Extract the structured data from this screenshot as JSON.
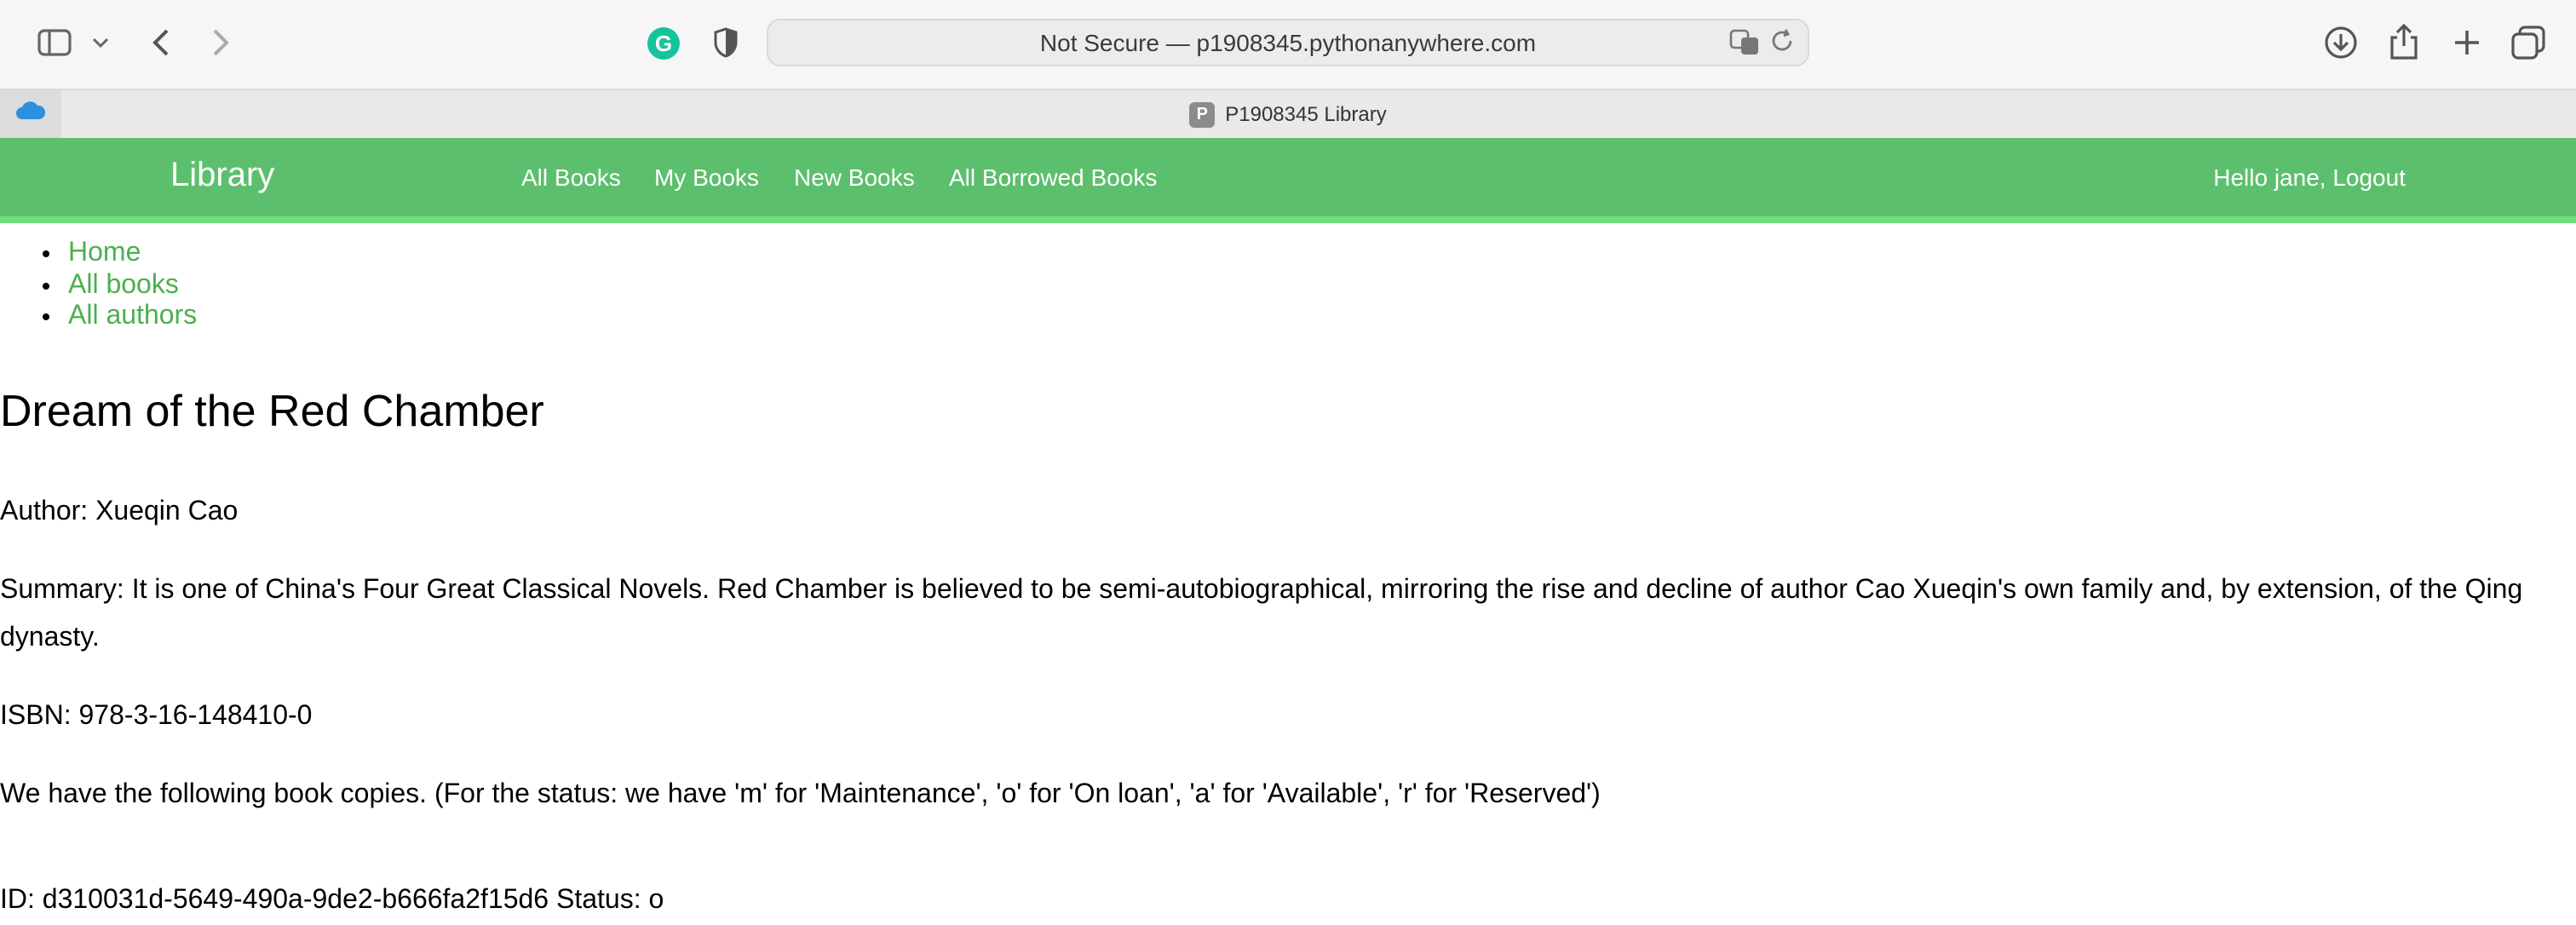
{
  "browser": {
    "address": "Not Secure — p1908345.pythonanywhere.com",
    "tab_title": "P1908345 Library",
    "favicon_letter": "P",
    "grammarly_letter": "G"
  },
  "navbar": {
    "brand": "Library",
    "links": [
      "All Books",
      "My Books",
      "New Books",
      "All Borrowed Books"
    ],
    "user": "Hello jane, Logout"
  },
  "breadcrumbs": [
    "Home",
    "All books",
    "All authors"
  ],
  "book": {
    "title": "Dream of the Red Chamber",
    "author": "Author: Xueqin Cao",
    "summary": "Summary: It is one of China's Four Great Classical Novels. Red Chamber is believed to be semi-autobiographical, mirroring the rise and decline of author Cao Xueqin's own family and, by extension, of the Qing dynasty.",
    "isbn": "ISBN: 978-3-16-148410-0",
    "copies_intro": "We have the following book copies. (For the status: we have 'm' for 'Maintenance', 'o' for 'On loan', 'a' for 'Available', 'r' for 'Reserved')",
    "copy_line": "ID: d310031d-5649-490a-9de2-b666fa2f15d6 Status: o"
  },
  "colors": {
    "navbar": "#5cbf6d",
    "link": "#4caf50"
  }
}
